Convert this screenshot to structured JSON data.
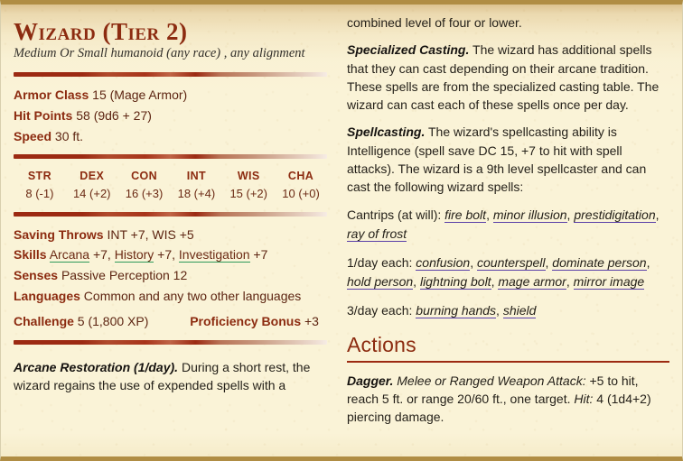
{
  "statblock": {
    "name": "Wizard (Tier 2)",
    "meta": "Medium Or Small humanoid (any race) , any alignment",
    "armor_class": {
      "label": "Armor Class",
      "value": "15 (Mage Armor)"
    },
    "hit_points": {
      "label": "Hit Points",
      "value": "58 (9d6 + 27)"
    },
    "speed": {
      "label": "Speed",
      "value": "30 ft."
    },
    "abilities": [
      {
        "name": "STR",
        "score": "8",
        "modifier": "(-1)"
      },
      {
        "name": "DEX",
        "score": "14",
        "modifier": "(+2)"
      },
      {
        "name": "CON",
        "score": "16",
        "modifier": "(+3)"
      },
      {
        "name": "INT",
        "score": "18",
        "modifier": "(+4)"
      },
      {
        "name": "WIS",
        "score": "15",
        "modifier": "(+2)"
      },
      {
        "name": "CHA",
        "score": "10",
        "modifier": "(+0)"
      }
    ],
    "saving_throws": {
      "label": "Saving Throws",
      "value": "INT +7, WIS +5"
    },
    "skills": {
      "label": "Skills",
      "entries": [
        {
          "name": "Arcana",
          "bonus": "+7"
        },
        {
          "name": "History",
          "bonus": "+7"
        },
        {
          "name": "Investigation",
          "bonus": "+7"
        }
      ]
    },
    "senses": {
      "label": "Senses",
      "value": "Passive Perception 12"
    },
    "languages": {
      "label": "Languages",
      "value": "Common and any two other languages"
    },
    "challenge": {
      "label": "Challenge",
      "value": "5 (1,800 XP)"
    },
    "proficiency_bonus": {
      "label": "Proficiency Bonus",
      "value": "+3"
    },
    "traits_left": [
      {
        "name": "Arcane Restoration (1/day).",
        "text": "During a short rest, the wizard regains the use of expended spells with a"
      }
    ],
    "right_column": {
      "continuation": "combined level of four or lower.",
      "traits": [
        {
          "name": "Specialized Casting.",
          "text": "The wizard has additional spells that they can cast depending on their arcane tradition. These spells are from the specialized casting table. The wizard can cast each of these spells once per day."
        },
        {
          "name": "Spellcasting.",
          "text": "The wizard's spellcasting ability is Intelligence (spell save DC 15, +7 to hit with spell attacks). The wizard is a 9th level spellcaster and can cast the following wizard spells:"
        }
      ],
      "spell_groups": [
        {
          "frequency": "Cantrips (at will):",
          "spells": [
            "fire bolt",
            "minor illusion",
            "prestidigitation",
            "ray of frost"
          ]
        },
        {
          "frequency": "1/day each:",
          "spells": [
            "confusion",
            "counterspell",
            "dominate person",
            "hold person",
            "lightning bolt",
            "mage armor",
            "mirror image"
          ]
        },
        {
          "frequency": "3/day each:",
          "spells": [
            "burning hands",
            "shield"
          ]
        }
      ],
      "actions_heading": "Actions",
      "actions": [
        {
          "name": "Dagger.",
          "attack_type": "Melee or Ranged Weapon Attack:",
          "attack_detail": " +5 to hit, reach 5 ft. or range 20/60 ft., one target. ",
          "hit_label": "Hit:",
          "hit_detail": " 4 (1d4+2) piercing damage."
        }
      ]
    }
  }
}
